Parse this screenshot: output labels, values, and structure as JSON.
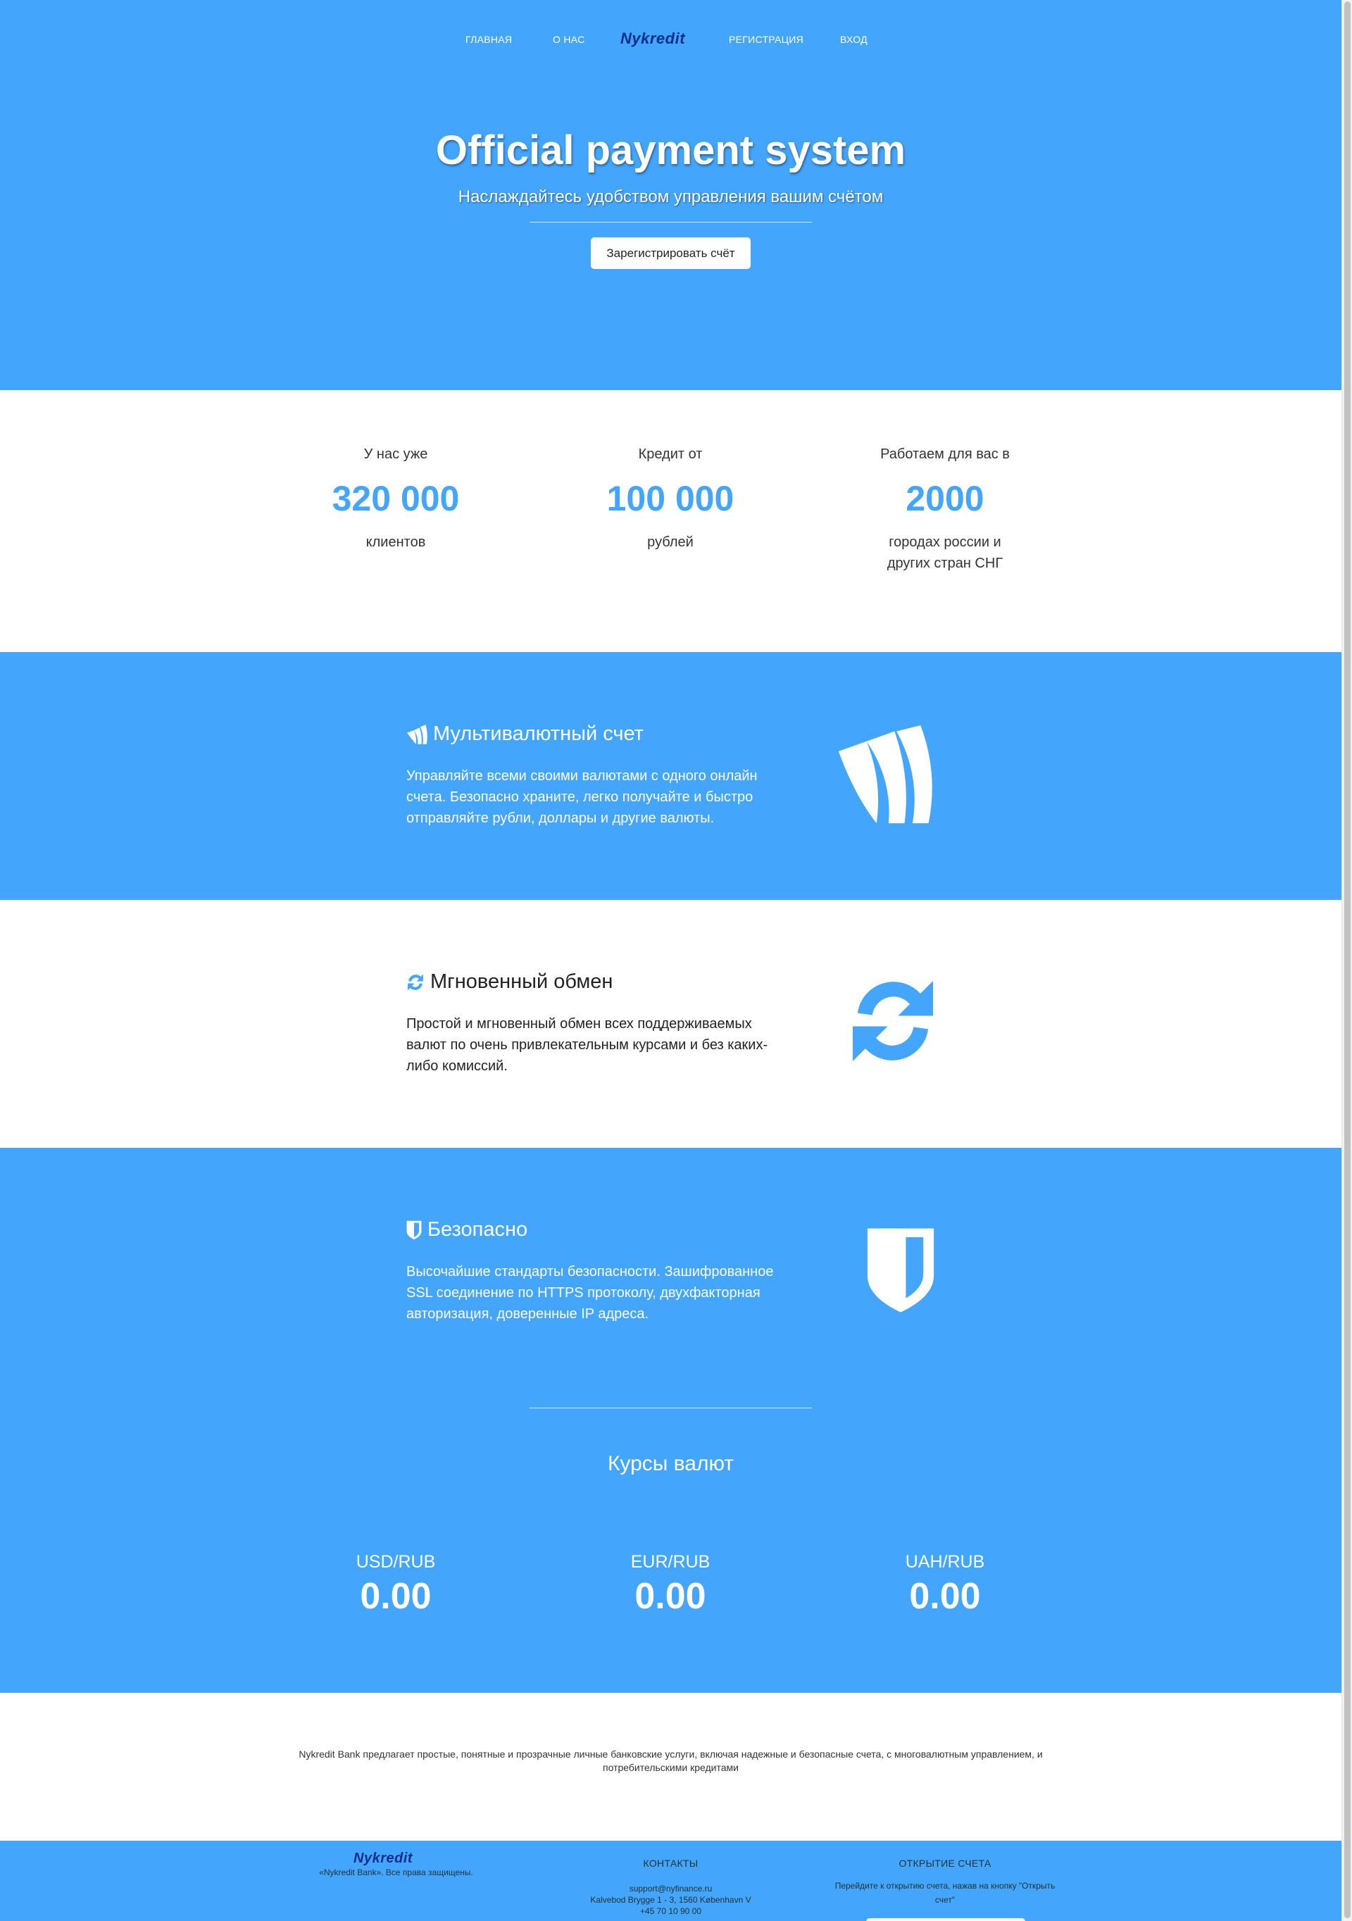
{
  "nav": {
    "home": "ГЛАВНАЯ",
    "about": "О НАС",
    "logo": "Nykredit",
    "register": "РЕГИСТРАЦИЯ",
    "login": "ВХОД"
  },
  "hero": {
    "title": "Official payment system",
    "subtitle": "Наслаждайтесь удобством управления вашим счётом",
    "button": "Зарегистрировать счёт"
  },
  "stats": [
    {
      "top": "У нас уже",
      "value": "320 000",
      "bottom": "клиентов"
    },
    {
      "top": "Кредит от",
      "value": "100 000",
      "bottom": "рублей"
    },
    {
      "top": "Работаем для вас в",
      "value": "2000",
      "bottom_1": "городах россии и",
      "bottom_2": "других стран СНГ"
    }
  ],
  "features": [
    {
      "icon": "wallet-w-icon",
      "title": "Мультивалютный счет",
      "desc_1": "Управляйте всеми своими валютами с одного онлайн",
      "desc_2": "счета. Безопасно храните, легко получайте и быстро",
      "desc_3": "отправляйте рубли, доллары и другие валюты."
    },
    {
      "icon": "refresh-icon",
      "title": "Мгновенный обмен",
      "desc_1": "Простой и мгновенный обмен всех поддерживаемых",
      "desc_2": "валют по очень привлекательным курсами и без каких-",
      "desc_3": "либо комиссий."
    },
    {
      "icon": "shield-icon",
      "title": "Безопасно",
      "desc_1": "Высочайшие стандарты безопасности. Зашифрованное",
      "desc_2": "SSL соединение по HTTPS протоколу, двухфакторная",
      "desc_3": "авторизация, доверенные IP адреса."
    }
  ],
  "rates": {
    "title": "Курсы валют",
    "items": [
      {
        "pair": "USD/RUB",
        "value": "0.00"
      },
      {
        "pair": "EUR/RUB",
        "value": "0.00"
      },
      {
        "pair": "UAH/RUB",
        "value": "0.00"
      }
    ]
  },
  "about": {
    "line_1": "Nykredit Bank предлагает простые, понятные и прозрачные личные банковские услуги, включая надежные и безопасные счета, с многовалютным управлением, и",
    "line_2": "потребительскими кредитами"
  },
  "footer": {
    "logo": "Nykredit",
    "copyright": "«Nykredit Bank». Все права защищены.",
    "contacts_title": "КОНТАКТЫ",
    "email": "support@nyfinance.ru",
    "address": "Kalvebod Brygge 1 - 3, 1560 København V",
    "phone": "+45 70 10 90 00",
    "open_title": "ОТКРЫТИЕ СЧЕТА",
    "open_text_1": "Перейдите к открытию счета, нажав на кнопку \"Открыть",
    "open_text_2": "счет\""
  },
  "colors": {
    "brand_blue": "#43a5fb",
    "logo_navy": "#0b2f8a",
    "white": "#ffffff"
  }
}
